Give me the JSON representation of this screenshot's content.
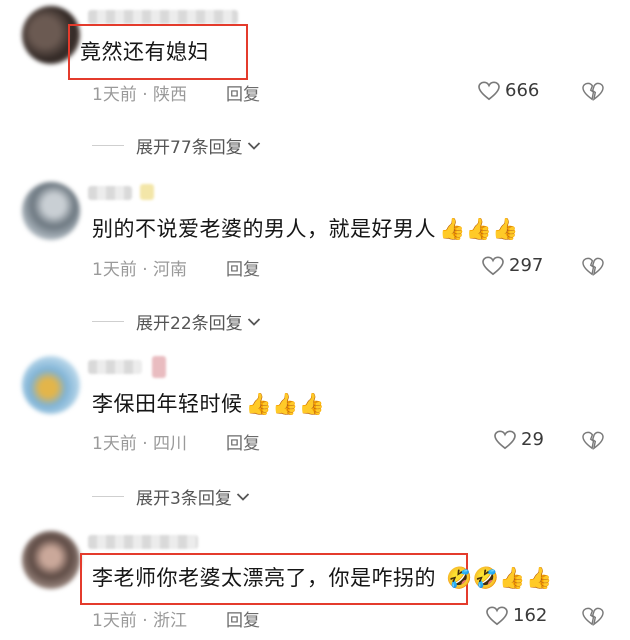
{
  "comments": [
    {
      "text": "竟然还有媳妇",
      "time": "1天前",
      "location": "陕西",
      "reply_label": "回复",
      "likes": "666",
      "expand_label": "展开77条回复",
      "highlighted": true,
      "emoji": ""
    },
    {
      "text": "别的不说爱老婆的男人，就是好男人",
      "time": "1天前",
      "location": "河南",
      "reply_label": "回复",
      "likes": "297",
      "expand_label": "展开22条回复",
      "highlighted": false,
      "emoji": "👍👍👍"
    },
    {
      "text": "李保田年轻时候",
      "time": "1天前",
      "location": "四川",
      "reply_label": "回复",
      "likes": "29",
      "expand_label": "展开3条回复",
      "highlighted": false,
      "emoji": "👍👍👍"
    },
    {
      "text": "李老师你老婆太漂亮了，你是咋拐的",
      "time": "1天前",
      "location": "浙江",
      "reply_label": "回复",
      "likes": "162",
      "highlighted": true,
      "emoji": "🤣🤣👍👍"
    }
  ],
  "meta_separator": "·",
  "colors": {
    "highlight_border": "#e43b2c",
    "meta_text": "#9a9a9a",
    "text": "#161616"
  },
  "icons": {
    "like": "heart-outline-icon",
    "dislike": "broken-heart-icon",
    "expand": "chevron-down-icon"
  }
}
